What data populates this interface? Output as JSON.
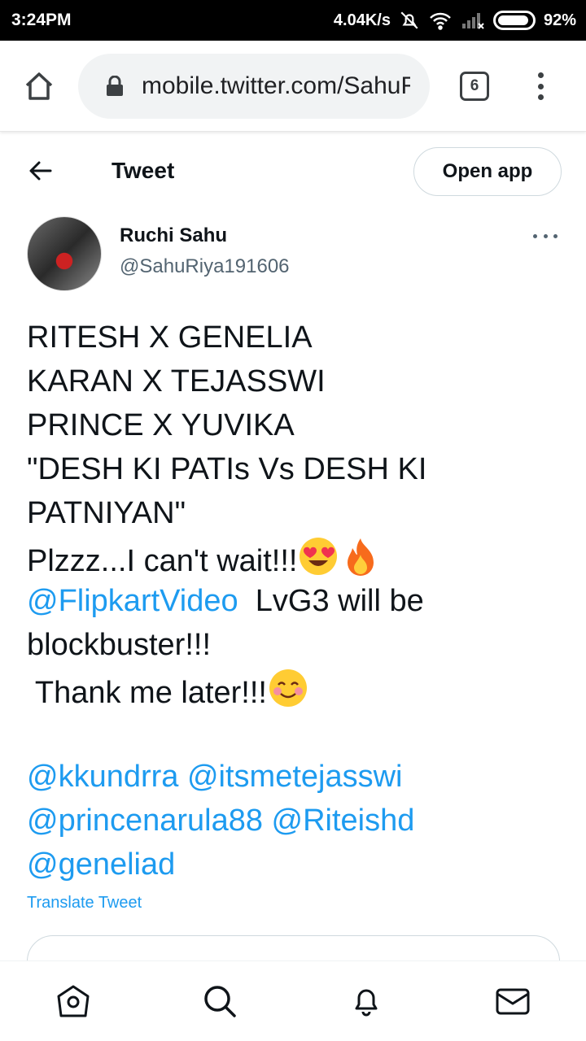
{
  "status_bar": {
    "time": "3:24PM",
    "net_speed": "4.04K/s",
    "battery": "92%",
    "battery_level": 0.92
  },
  "browser": {
    "url": "mobile.twitter.com/SahuRiya191606",
    "tab_count": "6"
  },
  "header": {
    "title": "Tweet",
    "open_app": "Open app"
  },
  "author": {
    "name": "Ruchi Sahu",
    "handle": "@SahuRiya191606"
  },
  "tweet": {
    "line1": "RITESH X GENELIA",
    "line2": "KARAN X TEJASSWI",
    "line3": "PRINCE X YUVIKA",
    "line4": "\"DESH KI PATIs Vs DESH KI",
    "line5": "PATNIYAN\"",
    "line6": "Plzzz...I can't wait!!!",
    "line7_mention": "@FlipkartVideo",
    "line7_rest": "  LvG3 will be",
    "line8": "blockbuster!!!",
    "line9": " Thank me later!!!",
    "mentions_line1": "@kkundrra @itsmetejasswi",
    "mentions_line2": "@princenarula88 @Riteishd",
    "mentions_line3": "@geneliad",
    "translate": "Translate Tweet"
  },
  "icons": {
    "home": "home-icon",
    "lock": "lock-icon",
    "menu": "more-vertical-icon",
    "back": "back-arrow-icon",
    "more": "more-horizontal-icon",
    "nav": [
      "home-icon",
      "search-icon",
      "notifications-icon",
      "messages-icon"
    ]
  },
  "colors": {
    "accent": "#1d9bf0",
    "text": "#0f1419",
    "secondary": "#536471"
  }
}
